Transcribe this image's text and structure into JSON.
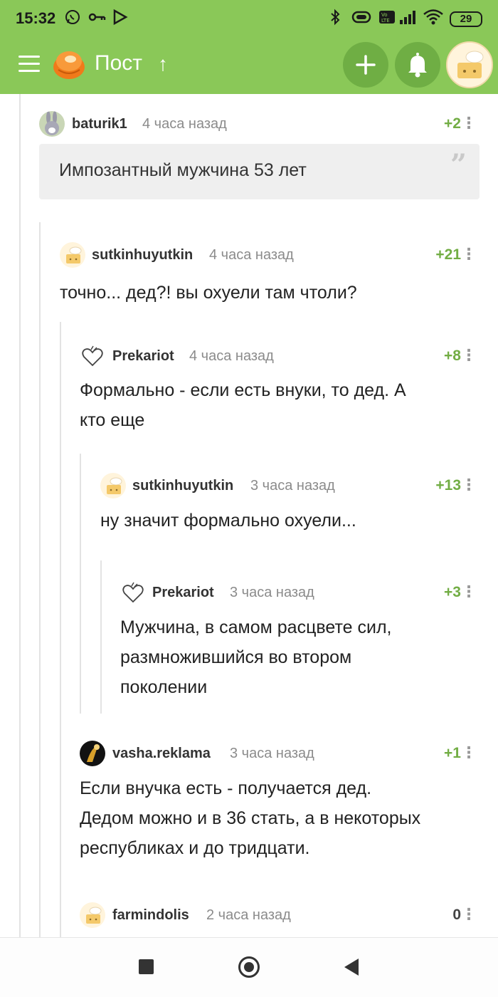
{
  "status_bar": {
    "time": "15:32",
    "left_icons": [
      "whatsapp-icon",
      "key-icon",
      "play-icon"
    ],
    "right_icons": [
      "bluetooth-icon",
      "vibrate-icon",
      "volte-icon",
      "signal-icon",
      "wifi-icon"
    ],
    "battery": "29"
  },
  "app_bar": {
    "title": "Пост",
    "up_arrow": "↑",
    "add_label": "+",
    "colors": {
      "bar": "#8ac858",
      "button": "#6fae44"
    }
  },
  "comments": [
    {
      "user": "baturik1",
      "time": "4 часа назад",
      "rating": "+2",
      "quote": "Импозантный мужчина 53 лет",
      "avatar": "bunny-avatar"
    },
    {
      "user": "sutkinhuyutkin",
      "time": "4 часа назад",
      "rating": "+21",
      "text": "точно... дед?! вы охуели там чтоли?",
      "avatar": "default-avatar"
    },
    {
      "user": "Prekariot",
      "time": "4 часа назад",
      "rating": "+8",
      "text_lines": [
        "Формально - если есть внуки, то дед. А",
        "кто еще"
      ],
      "avatar": "heart-outline-avatar"
    },
    {
      "user": "sutkinhuyutkin",
      "time": "3 часа назад",
      "rating": "+13",
      "text": "ну значит формально охуели...",
      "avatar": "default-avatar"
    },
    {
      "user": "Prekariot",
      "time": "3 часа назад",
      "rating": "+3",
      "text_lines": [
        "Мужчина, в самом расцвете сил,",
        "размножившийся во втором",
        "поколении"
      ],
      "avatar": "heart-outline-avatar"
    },
    {
      "user": "vasha.reklama",
      "time": "3 часа назад",
      "rating": "+1",
      "text_lines": [
        "Если внучка есть - получается дед.",
        "Дедом можно и в 36 стать, а в некоторых",
        "республиках и до тридцати."
      ],
      "avatar": "dark-avatar"
    },
    {
      "user": "farmindolis",
      "time": "2 часа назад",
      "rating": "0",
      "avatar": "default-avatar"
    }
  ],
  "quote_mark": "”",
  "more_glyph": "⋮",
  "nav_bar": {
    "buttons": [
      "recents-button",
      "home-button",
      "back-button"
    ]
  }
}
